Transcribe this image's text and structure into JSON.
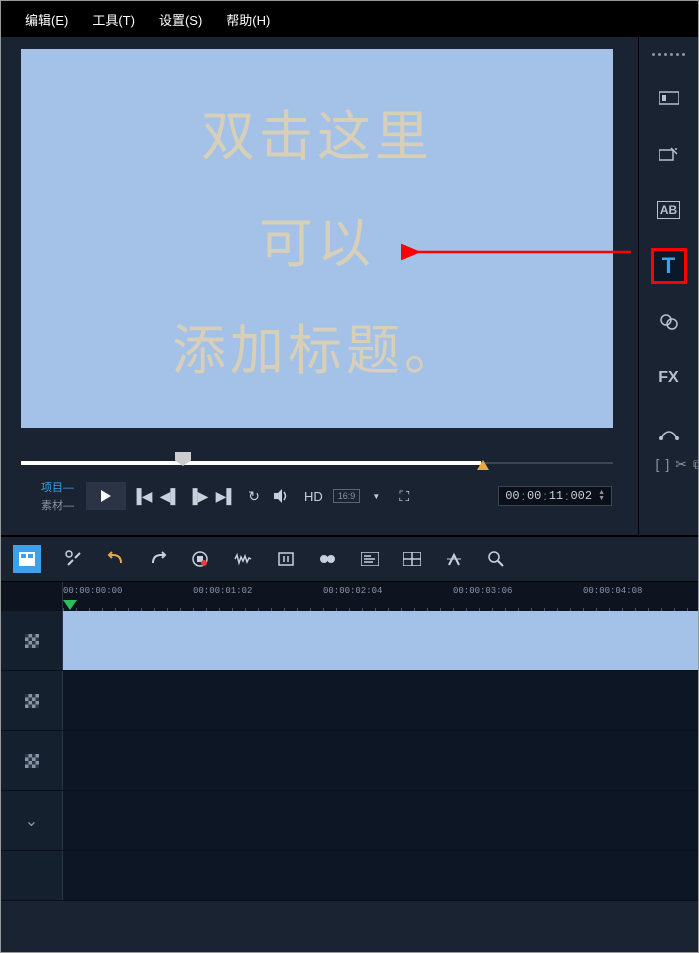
{
  "menu": {
    "edit": "编辑(E)",
    "tools": "工具(T)",
    "settings": "设置(S)",
    "help": "帮助(H)"
  },
  "preview": {
    "line1": "双击这里",
    "line2": "可以",
    "line3": "添加标题。"
  },
  "playback": {
    "project_tab": "项目—",
    "material_tab": "素材—",
    "hd_label": "HD",
    "aspect": "16:9",
    "timecode": {
      "h": "00",
      "m": "00",
      "s": "11",
      "f": "002"
    }
  },
  "right_tools": {
    "fx_label": "FX",
    "ab_label": "AB",
    "t_label": "T"
  },
  "timeline": {
    "marks": [
      {
        "label": "00:00:00:00",
        "pos": 0
      },
      {
        "label": "00:00:01:02",
        "pos": 130
      },
      {
        "label": "00:00:02:04",
        "pos": 260
      },
      {
        "label": "00:00:03:06",
        "pos": 390
      },
      {
        "label": "00:00:04:08",
        "pos": 520
      }
    ]
  }
}
